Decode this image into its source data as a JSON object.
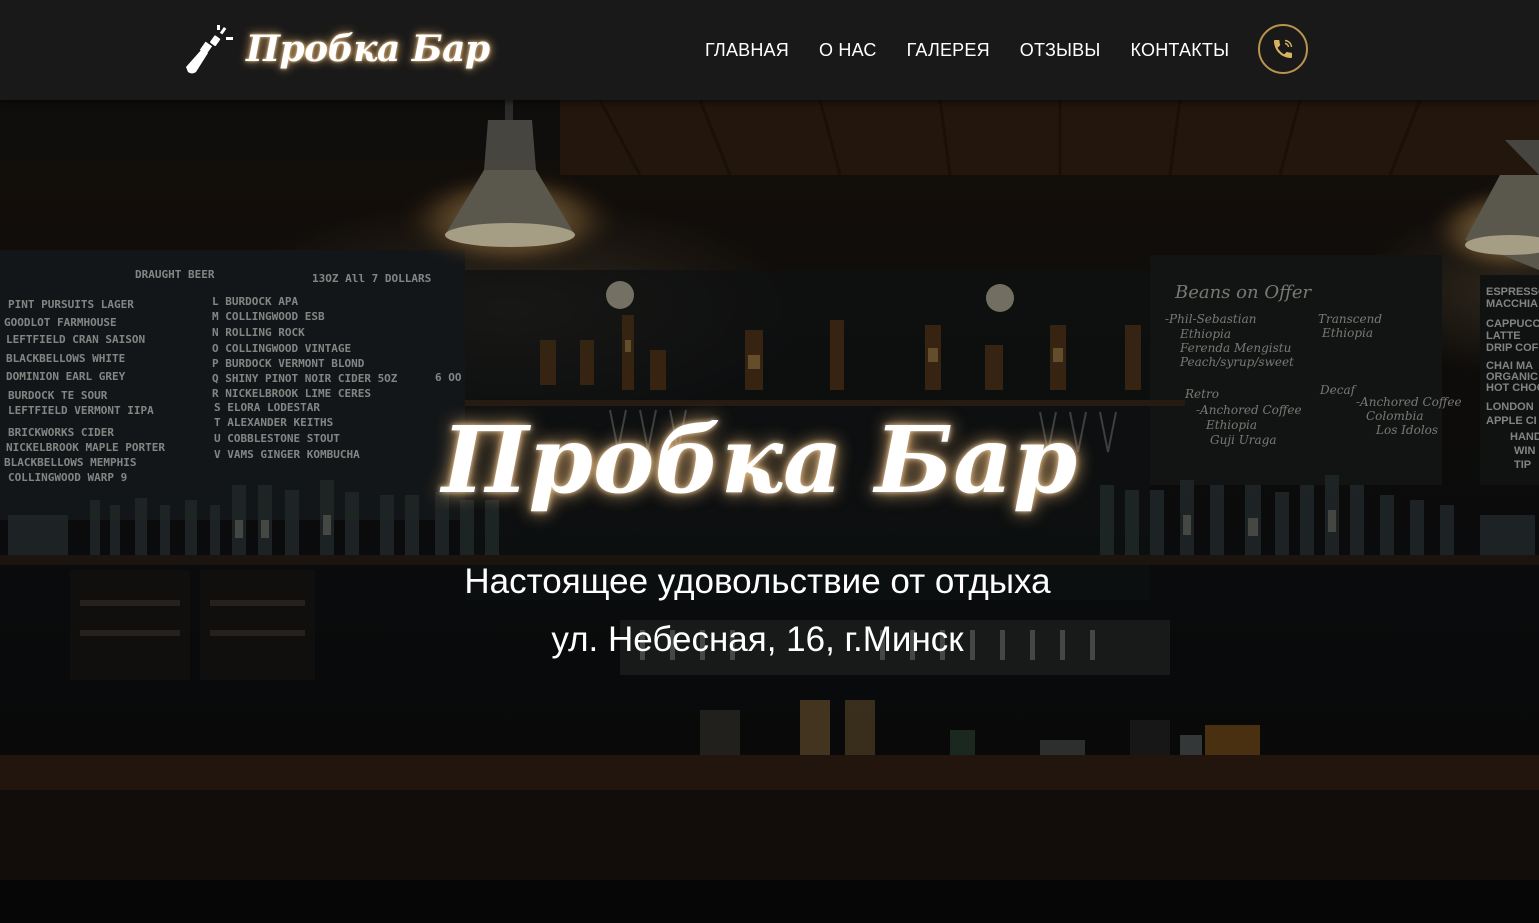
{
  "header": {
    "logo_text": "Пробка Бар",
    "logo_icon": "champagne-pop-icon",
    "nav": [
      "ГЛАВНАЯ",
      "О НАС",
      "ГАЛЕРЕЯ",
      "ОТЗЫВЫ",
      "КОНТАКТЫ"
    ],
    "phone_icon": "phone-icon",
    "accent_color": "#b8944d"
  },
  "hero": {
    "title": "Пробка Бар",
    "tagline": "Настоящее удовольствие от отдыха",
    "address": "ул. Небесная, 16, г.Минск",
    "background": "bar-interior-photo",
    "chalkboard_left": {
      "heading": "DRAUGHT   BEER",
      "price_note": "13OZ   All 7 DOLLARS",
      "items_col1": [
        "PINT PURSUITS  LAGER",
        "GOODLOT    FARMHOUSE",
        "LEFTFIELD CRAN  SAISON",
        "BLACKBELLOWS   WHITE",
        "DOMINION EARL  GREY",
        "BURDOCK  TE    SOUR",
        "LEFTFIELD  VERMONT  IIPA",
        "BRICKWORKS   CIDER",
        "NICKELBROOK  MAPLE  PORTER",
        "BLACKBELLOWS  MEMPHIS",
        "COLLINGWOOD   WARP 9"
      ],
      "items_col2": [
        "L  BURDOCK   APA",
        "M COLLINGWOOD  ESB",
        "N  ROLLING ROCK",
        "O  COLLINGWOOD  VINTAGE",
        "P  BURDOCK  VERMONT  BLOND",
        "Q  SHINY PINOT NOIR CIDER   5OZ",
        "R  NICKELBROOK  LIME  CERES",
        "S  ELORA  LODESTAR",
        "T ALEXANDER   KEITHS",
        "U  COBBLESTONE  STOUT",
        "V  VAMS  GINGER  KOMBUCHA"
      ],
      "side_price": "6 OO"
    },
    "chalkboard_right": {
      "heading": "Beans on Offer",
      "lines": [
        "-Phil-Sebastian",
        "Ethiopia",
        "Ferenda Mengistu",
        "Peach/syrup/sweet",
        "Retro",
        "-Anchored Coffee",
        "Ethiopia",
        "Guji Uraga",
        "Transcend",
        "Ethiopia",
        "Decaf",
        "-Anchored Coffee",
        "Colombia",
        "Los Idolos"
      ]
    },
    "chalkboard_edge": {
      "lines": [
        "ESPRESSO",
        "MACCHIA",
        "CAPPUCC",
        "LATTE",
        "DRIP COF",
        "CHAI MA",
        "ORGANIC",
        "HOT CHOC",
        "LONDON",
        "APPLE CI",
        "HAND",
        "WIN",
        "TIP"
      ]
    }
  }
}
